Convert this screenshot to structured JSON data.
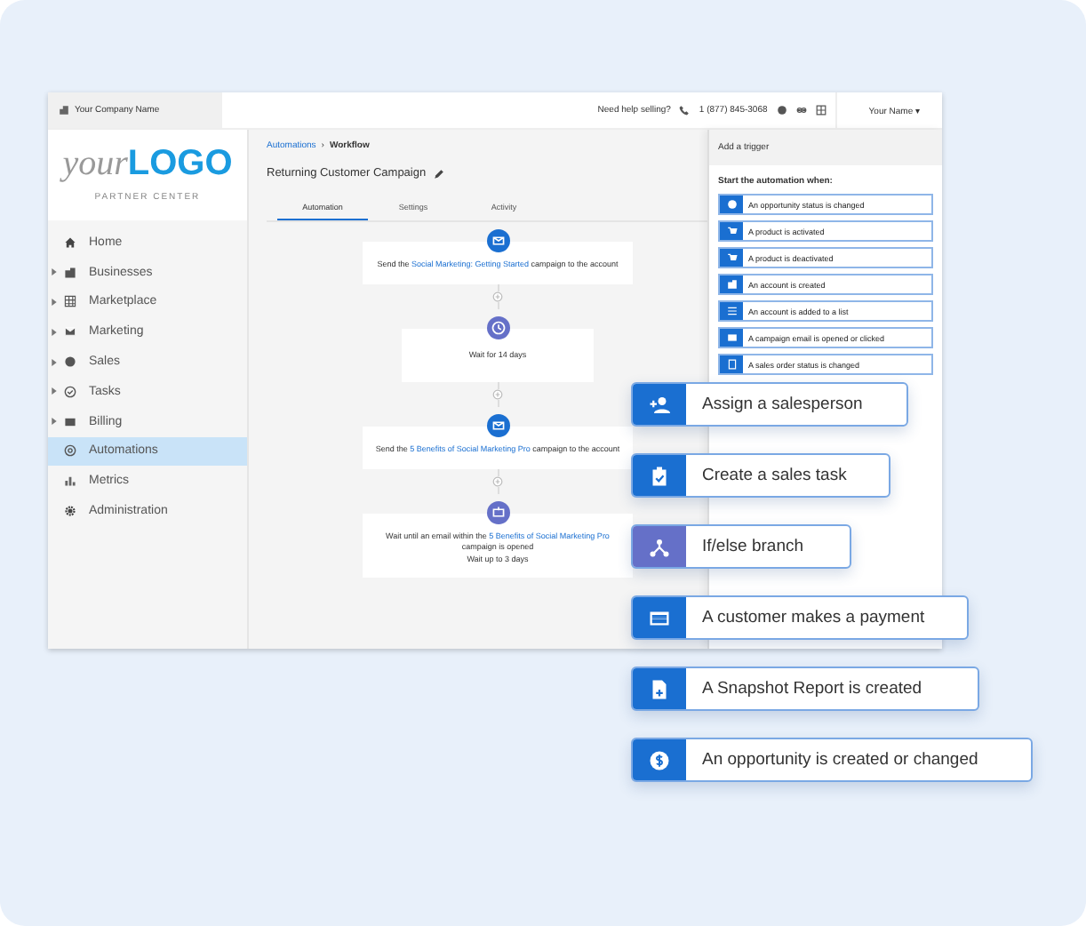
{
  "topbar": {
    "company": "Your Company Name",
    "help": "Need help selling?",
    "phone": "1 (877) 845-3068",
    "user": "Your Name ▾"
  },
  "sidebar": {
    "logo_light": "your",
    "logo_bold": "LOGO",
    "subtitle": "PARTNER CENTER",
    "items": [
      {
        "label": "Home",
        "expandable": false,
        "selected": false
      },
      {
        "label": "Businesses",
        "expandable": true,
        "selected": false
      },
      {
        "label": "Marketplace",
        "expandable": true,
        "selected": false
      },
      {
        "label": "Marketing",
        "expandable": true,
        "selected": false
      },
      {
        "label": "Sales",
        "expandable": true,
        "selected": false
      },
      {
        "label": "Tasks",
        "expandable": true,
        "selected": false
      },
      {
        "label": "Billing",
        "expandable": true,
        "selected": false
      },
      {
        "label": "Automations",
        "expandable": false,
        "selected": true
      },
      {
        "label": "Metrics",
        "expandable": false,
        "selected": false
      },
      {
        "label": "Administration",
        "expandable": false,
        "selected": false
      }
    ]
  },
  "breadcrumb": {
    "parent": "Automations",
    "separator": "›",
    "current": "Workflow"
  },
  "title": "Returning Customer Campaign",
  "tabs": [
    {
      "label": "Automation",
      "selected": true
    },
    {
      "label": "Settings",
      "selected": false
    },
    {
      "label": "Activity",
      "selected": false
    }
  ],
  "steps": [
    {
      "kind": "email",
      "before": "Send the ",
      "link": "Social Marketing: Getting Started",
      "after": " campaign to the account"
    },
    {
      "kind": "wait",
      "before": "Wait for 14 days"
    },
    {
      "kind": "email",
      "before": "Send the ",
      "link": "5 Benefits of Social Marketing Pro",
      "after": " campaign to the account"
    },
    {
      "kind": "wait_email",
      "before": "Wait until an email within the ",
      "link": "5 Benefits of Social Marketing Pro",
      "after": " campaign is opened",
      "note": "Wait up to 3 days"
    }
  ],
  "trigger_panel": {
    "title": "Add a trigger",
    "prompt": "Start the automation when:",
    "items": [
      {
        "label": "An opportunity status is changed"
      },
      {
        "label": "A product is activated"
      },
      {
        "label": "A product is deactivated"
      },
      {
        "label": "An account is created"
      },
      {
        "label": "An account is added to a list"
      },
      {
        "label": "A campaign email is opened or clicked"
      },
      {
        "label": "A sales order status is changed"
      }
    ]
  },
  "floating_cards": [
    {
      "label": "Assign a salesperson",
      "color": "#1a6fd1"
    },
    {
      "label": "Create a sales task",
      "color": "#1a6fd1"
    },
    {
      "label": "If/else branch",
      "color": "#6570c8"
    },
    {
      "label": "A customer makes a payment",
      "color": "#1a6fd1"
    },
    {
      "label": "A Snapshot Report is created",
      "color": "#1a6fd1"
    },
    {
      "label": "An opportunity is created or changed",
      "color": "#1a6fd1"
    }
  ]
}
